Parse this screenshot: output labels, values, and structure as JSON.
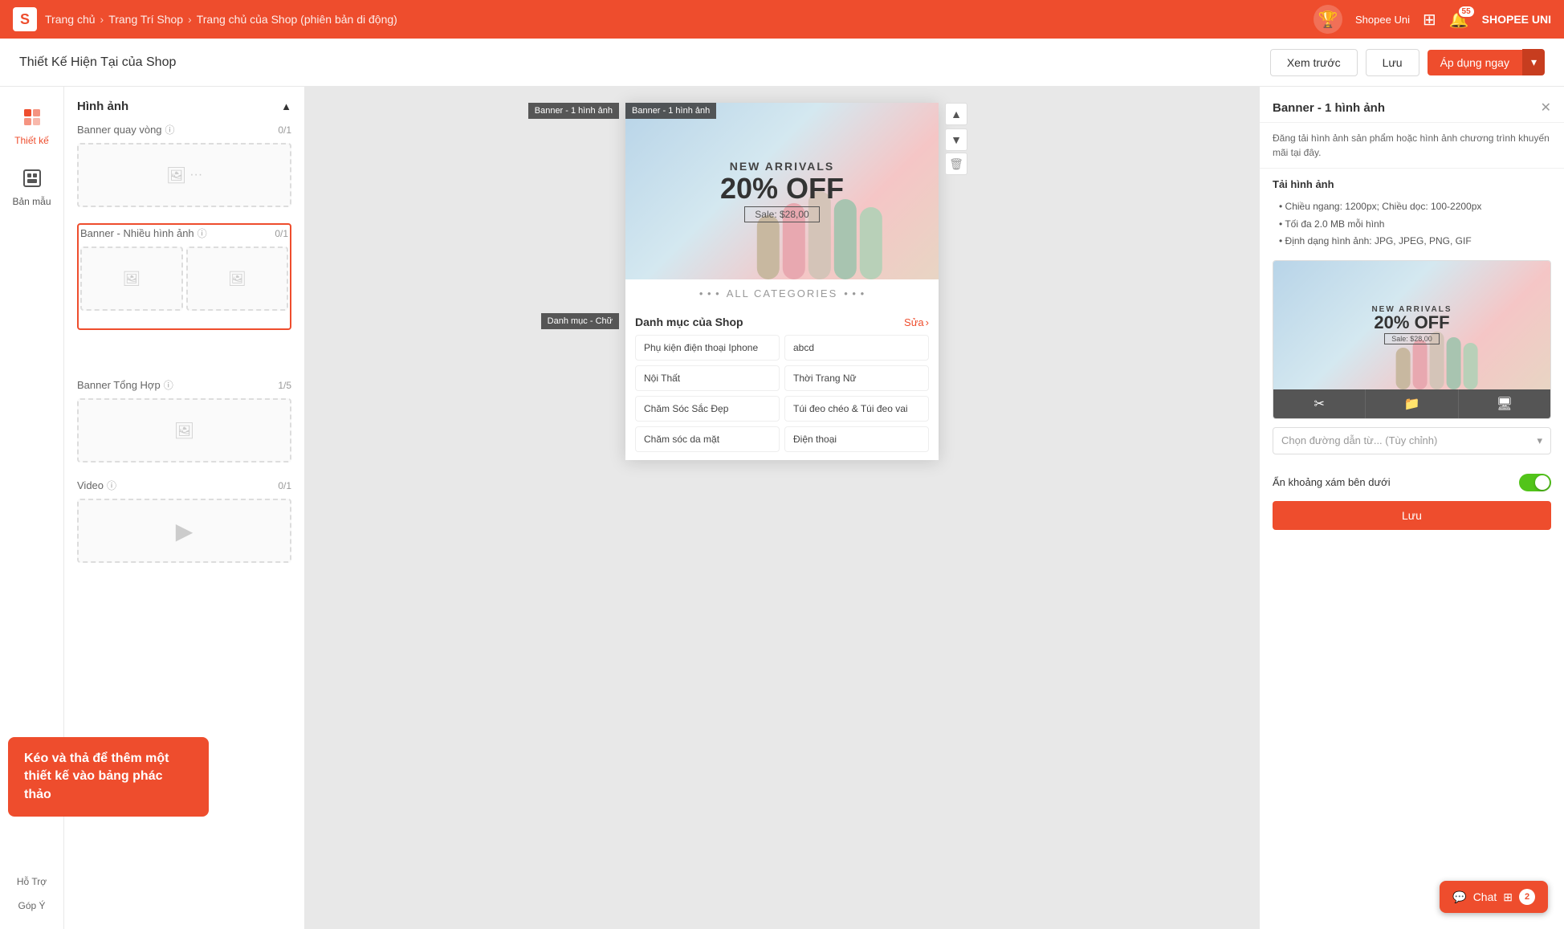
{
  "topnav": {
    "breadcrumb": [
      "Trang chủ",
      "Trang Trí Shop",
      "Trang chủ của Shop (phiên bản di động)"
    ],
    "shopee_uni": "Shopee Uni",
    "bell_count": "55",
    "user_name": "SHOPEE UNI"
  },
  "toolbar": {
    "title": "Thiết Kế Hiện Tại của Shop",
    "preview_label": "Xem trước",
    "save_label": "Lưu",
    "apply_label": "Áp dụng ngay"
  },
  "left_sidebar": {
    "items": [
      {
        "id": "thiet-ke",
        "label": "Thiết kế",
        "icon": "⊞",
        "active": true
      },
      {
        "id": "ban-mau",
        "label": "Bản mẫu",
        "icon": "▦",
        "active": false
      }
    ],
    "bottom": [
      {
        "id": "ho-tro",
        "label": "Hỗ Trợ"
      },
      {
        "id": "gop-y",
        "label": "Góp Ý"
      }
    ]
  },
  "panel": {
    "title": "Hình ảnh",
    "sections": [
      {
        "id": "banner-quay-vong",
        "label": "Banner quay vòng",
        "count": "0/1",
        "type": "single"
      },
      {
        "id": "banner-nhieu-hinh-anh",
        "label": "Banner - Nhiều hình ảnh",
        "count": "0/1",
        "selected": true,
        "type": "double"
      },
      {
        "id": "banner-tong-hop",
        "label": "Banner Tổng Hợp",
        "count": "1/5",
        "type": "composite"
      },
      {
        "id": "video",
        "label": "Video",
        "count": "0/1",
        "type": "video"
      }
    ]
  },
  "canvas": {
    "banner_tag": "Banner - 1 hình ảnh",
    "new_arrivals": "NEW ARRIVALS",
    "percent_off": "20% OFF",
    "sale_price": "Sale: $28,00",
    "all_categories": "ALL CATEGORIES",
    "categories_title": "Danh mục của Shop",
    "categories_edit": "Sửa",
    "section_tag_1": "Banner - 1 hình ảnh",
    "section_tag_2": "Danh mục - Chữ",
    "categories": [
      {
        "col1": "Phụ kiện điện thoại Iphone",
        "col2": "abcd"
      },
      {
        "col1": "Nội Thất",
        "col2": "Thời Trang Nữ"
      },
      {
        "col1": "Chăm Sóc Sắc Đẹp",
        "col2": "Túi đeo chéo & Túi đeo vai"
      },
      {
        "col1": "Chăm sóc da mặt",
        "col2": "Điện thoại"
      }
    ]
  },
  "drag_tooltip": {
    "text": "Kéo và thả để thêm một thiết kế vào bảng phác thảo"
  },
  "right_panel": {
    "title": "Banner - 1 hình ảnh",
    "description": "Đăng tải hình ảnh sản phẩm hoặc hình ảnh chương trình khuyến mãi tại đây.",
    "upload_section": "Tải hình ảnh",
    "specs": [
      "Chiều ngang: 1200px; Chiều dọc: 100-2200px",
      "Tối đa 2.0 MB mỗi hình",
      "Định dạng hình ảnh: JPG, JPEG, PNG, GIF"
    ],
    "preview": {
      "new_arrivals": "NEW ARRIVALS",
      "percent_off": "20% OFF",
      "sale_price": "Sale: $28,00"
    },
    "select_placeholder": "Chọn đường dẫn từ... (Tùy chỉnh)",
    "toggle_label": "Ẩn khoảng xám bên dưới",
    "save_btn": "Lưu"
  },
  "chat": {
    "label": "Chat",
    "count": "2"
  }
}
